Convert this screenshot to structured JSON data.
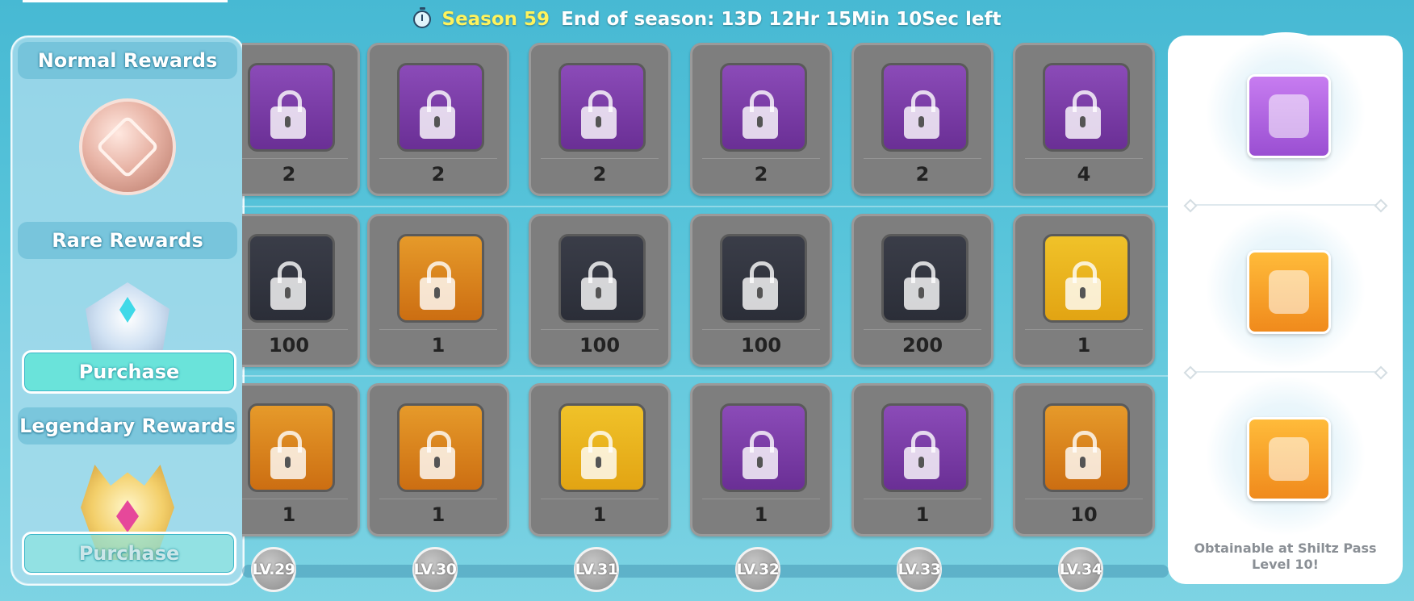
{
  "header": {
    "season_label": "Season 59",
    "countdown": "End of season: 13D 12Hr 15Min 10Sec left"
  },
  "left_panel": {
    "normal_label": "Normal Rewards",
    "rare_label": "Rare Rewards",
    "legendary_label": "Legendary Rewards",
    "rare_purchase": "Purchase",
    "legendary_purchase": "Purchase"
  },
  "levels": [
    "LV.29",
    "LV.30",
    "LV.31",
    "LV.32",
    "LV.33",
    "LV.34"
  ],
  "rows": {
    "normal": [
      {
        "icon": "coupon-icon",
        "bg": "purple",
        "qty": "2"
      },
      {
        "icon": "coupon-icon",
        "bg": "purple",
        "qty": "2"
      },
      {
        "icon": "coupon-icon",
        "bg": "purple",
        "qty": "2"
      },
      {
        "icon": "coupon-icon",
        "bg": "purple",
        "qty": "2"
      },
      {
        "icon": "coupon-icon",
        "bg": "purple",
        "qty": "2"
      },
      {
        "icon": "coupon-icon",
        "bg": "purple",
        "qty": "4"
      }
    ],
    "rare": [
      {
        "icon": "gem-icon",
        "bg": "dark",
        "qty": "100"
      },
      {
        "icon": "scroll-icon",
        "bg": "orange",
        "qty": "1"
      },
      {
        "icon": "gem-icon",
        "bg": "dark",
        "qty": "100"
      },
      {
        "icon": "gem-icon",
        "bg": "dark",
        "qty": "100"
      },
      {
        "icon": "gem-icon",
        "bg": "dark",
        "qty": "200"
      },
      {
        "icon": "teapot-icon",
        "bg": "yellow",
        "qty": "1"
      }
    ],
    "legendary": [
      {
        "icon": "ticket-card-icon",
        "bg": "orange",
        "qty": "1"
      },
      {
        "icon": "ticket-card-icon",
        "bg": "orange",
        "qty": "1"
      },
      {
        "icon": "gift-box-icon",
        "bg": "yellow",
        "qty": "1"
      },
      {
        "icon": "leaf-icon",
        "bg": "purple",
        "qty": "1"
      },
      {
        "icon": "gift-box-icon",
        "bg": "purple",
        "qty": "1"
      },
      {
        "icon": "ticket-card-icon",
        "bg": "orange",
        "qty": "10"
      }
    ]
  },
  "right_panel": {
    "rewards": [
      {
        "icon": "jar-icon",
        "bg": "purple"
      },
      {
        "icon": "scroll-icon",
        "bg": "orange"
      },
      {
        "icon": "winged-jar-icon",
        "bg": "orange"
      }
    ],
    "obtain_text": "Obtainable at Shiltz Pass Level 10!"
  },
  "colors": {
    "background": "#58c4da",
    "season_highlight": "#fff35c",
    "purchase_button": "#6ae3da",
    "locked_cell": "#7e7e7e"
  }
}
